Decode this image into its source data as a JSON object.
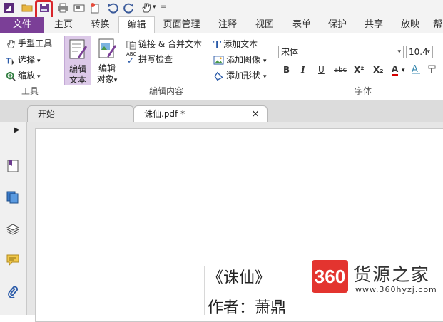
{
  "quick_access": {
    "overflow_symbol": "="
  },
  "tabs": [
    {
      "label": "文件"
    },
    {
      "label": "主页"
    },
    {
      "label": "转换"
    },
    {
      "label": "编辑"
    },
    {
      "label": "页面管理"
    },
    {
      "label": "注释"
    },
    {
      "label": "视图"
    },
    {
      "label": "表单"
    },
    {
      "label": "保护"
    },
    {
      "label": "共享"
    },
    {
      "label": "放映"
    },
    {
      "label": "帮"
    }
  ],
  "ribbon": {
    "tools": {
      "hand": "手型工具",
      "select": "选择",
      "zoom": "缩放",
      "group_label": "工具"
    },
    "edit_content": {
      "edit_text_l1": "编辑",
      "edit_text_l2": "文本",
      "edit_object_l1": "编辑",
      "edit_object_l2": "对象",
      "link_merge": "链接 & 合并文本",
      "spell_check": "拼写检查",
      "abc_badge": "ABC",
      "add_text": "添加文本",
      "add_image": "添加图像",
      "add_shape": "添加形状",
      "group_label": "编辑内容"
    },
    "font": {
      "font_name": "宋体",
      "font_size": "10.4",
      "bold": "B",
      "italic": "I",
      "underline": "U",
      "strike": "abc",
      "superscript": "X²",
      "subscript": "X₂",
      "font_color": "A",
      "group_label": "字体"
    }
  },
  "doc_tabs": {
    "home": "开始",
    "file": "诛仙.pdf *",
    "close": "×"
  },
  "document": {
    "line1": "《诛仙》",
    "line2": "作者：萧鼎"
  },
  "watermark": {
    "badge": "360",
    "name": "货源之家",
    "url": "www.360hyzj.com"
  },
  "colors": {
    "file_tab": "#7b3f97",
    "highlight": "#d9262c",
    "watermark": "#e3342f"
  }
}
